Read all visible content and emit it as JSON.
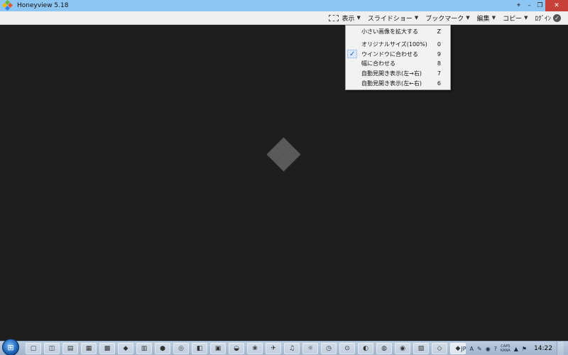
{
  "window": {
    "title": "Honeyview 5.18",
    "controls": {
      "pin": "⌖",
      "minimize": "–",
      "restore": "❐",
      "close": "✕"
    },
    "icon_colors": [
      "#6db33f",
      "#f5b800",
      "#e4572e",
      "#2f80ed"
    ]
  },
  "toolbar": {
    "items": [
      {
        "label": "表示",
        "icon": "view-frame-icon",
        "has_dropdown": true
      },
      {
        "label": "スライドショー",
        "has_dropdown": true
      },
      {
        "label": "ブックマーク",
        "has_dropdown": true
      },
      {
        "label": "編集",
        "has_dropdown": true
      },
      {
        "label": "コピー",
        "has_dropdown": true
      }
    ],
    "last_label": "ﾛｸﾞｲﾝ",
    "caret": "▼"
  },
  "view_menu": {
    "items": [
      {
        "label": "小さい画像を拡大する",
        "key": "Z",
        "checked": false
      },
      {
        "label": "オリジナルサイズ(100%)",
        "key": "0",
        "checked": false
      },
      {
        "label": "ウインドウに合わせる",
        "key": "9",
        "checked": true
      },
      {
        "label": "幅に合わせる",
        "key": "8",
        "checked": false
      },
      {
        "label": "自動見開き表示(左→右)",
        "key": "7",
        "checked": false
      },
      {
        "label": "自動見開き表示(左←右)",
        "key": "6",
        "checked": false
      }
    ],
    "check_mark": "✓"
  },
  "viewer": {
    "background": "#1e1e1e",
    "logo_color": "#5a5a5a"
  },
  "taskbar": {
    "tasks": [
      "▢",
      "◫",
      "▤",
      "▦",
      "▩",
      "◆",
      "▥",
      "●",
      "◎",
      "◧",
      "▣",
      "◒",
      "❀",
      "✈",
      "♫",
      "☼",
      "◷",
      "⊙",
      "◐",
      "◍",
      "◉",
      "▧",
      "◇",
      "◆"
    ],
    "tray": {
      "lang": "JP",
      "ime": "A",
      "caps_line1": "CAPS",
      "caps_line2": "KANA",
      "icons": [
        "✎",
        "◉",
        "?",
        "▲",
        "⚑"
      ],
      "clock": "14:22"
    }
  }
}
